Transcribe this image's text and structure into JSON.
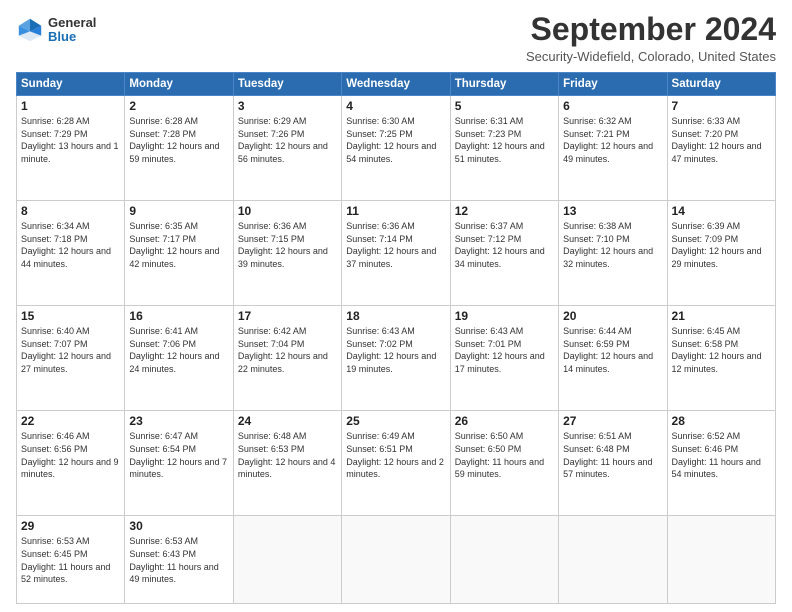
{
  "header": {
    "logo": {
      "general": "General",
      "blue": "Blue"
    },
    "title": "September 2024",
    "location": "Security-Widefield, Colorado, United States"
  },
  "days_of_week": [
    "Sunday",
    "Monday",
    "Tuesday",
    "Wednesday",
    "Thursday",
    "Friday",
    "Saturday"
  ],
  "weeks": [
    [
      {
        "day": 1,
        "sunrise": "6:28 AM",
        "sunset": "7:29 PM",
        "daylight": "13 hours and 1 minute."
      },
      {
        "day": 2,
        "sunrise": "6:28 AM",
        "sunset": "7:28 PM",
        "daylight": "12 hours and 59 minutes."
      },
      {
        "day": 3,
        "sunrise": "6:29 AM",
        "sunset": "7:26 PM",
        "daylight": "12 hours and 56 minutes."
      },
      {
        "day": 4,
        "sunrise": "6:30 AM",
        "sunset": "7:25 PM",
        "daylight": "12 hours and 54 minutes."
      },
      {
        "day": 5,
        "sunrise": "6:31 AM",
        "sunset": "7:23 PM",
        "daylight": "12 hours and 51 minutes."
      },
      {
        "day": 6,
        "sunrise": "6:32 AM",
        "sunset": "7:21 PM",
        "daylight": "12 hours and 49 minutes."
      },
      {
        "day": 7,
        "sunrise": "6:33 AM",
        "sunset": "7:20 PM",
        "daylight": "12 hours and 47 minutes."
      }
    ],
    [
      {
        "day": 8,
        "sunrise": "6:34 AM",
        "sunset": "7:18 PM",
        "daylight": "12 hours and 44 minutes."
      },
      {
        "day": 9,
        "sunrise": "6:35 AM",
        "sunset": "7:17 PM",
        "daylight": "12 hours and 42 minutes."
      },
      {
        "day": 10,
        "sunrise": "6:36 AM",
        "sunset": "7:15 PM",
        "daylight": "12 hours and 39 minutes."
      },
      {
        "day": 11,
        "sunrise": "6:36 AM",
        "sunset": "7:14 PM",
        "daylight": "12 hours and 37 minutes."
      },
      {
        "day": 12,
        "sunrise": "6:37 AM",
        "sunset": "7:12 PM",
        "daylight": "12 hours and 34 minutes."
      },
      {
        "day": 13,
        "sunrise": "6:38 AM",
        "sunset": "7:10 PM",
        "daylight": "12 hours and 32 minutes."
      },
      {
        "day": 14,
        "sunrise": "6:39 AM",
        "sunset": "7:09 PM",
        "daylight": "12 hours and 29 minutes."
      }
    ],
    [
      {
        "day": 15,
        "sunrise": "6:40 AM",
        "sunset": "7:07 PM",
        "daylight": "12 hours and 27 minutes."
      },
      {
        "day": 16,
        "sunrise": "6:41 AM",
        "sunset": "7:06 PM",
        "daylight": "12 hours and 24 minutes."
      },
      {
        "day": 17,
        "sunrise": "6:42 AM",
        "sunset": "7:04 PM",
        "daylight": "12 hours and 22 minutes."
      },
      {
        "day": 18,
        "sunrise": "6:43 AM",
        "sunset": "7:02 PM",
        "daylight": "12 hours and 19 minutes."
      },
      {
        "day": 19,
        "sunrise": "6:43 AM",
        "sunset": "7:01 PM",
        "daylight": "12 hours and 17 minutes."
      },
      {
        "day": 20,
        "sunrise": "6:44 AM",
        "sunset": "6:59 PM",
        "daylight": "12 hours and 14 minutes."
      },
      {
        "day": 21,
        "sunrise": "6:45 AM",
        "sunset": "6:58 PM",
        "daylight": "12 hours and 12 minutes."
      }
    ],
    [
      {
        "day": 22,
        "sunrise": "6:46 AM",
        "sunset": "6:56 PM",
        "daylight": "12 hours and 9 minutes."
      },
      {
        "day": 23,
        "sunrise": "6:47 AM",
        "sunset": "6:54 PM",
        "daylight": "12 hours and 7 minutes."
      },
      {
        "day": 24,
        "sunrise": "6:48 AM",
        "sunset": "6:53 PM",
        "daylight": "12 hours and 4 minutes."
      },
      {
        "day": 25,
        "sunrise": "6:49 AM",
        "sunset": "6:51 PM",
        "daylight": "12 hours and 2 minutes."
      },
      {
        "day": 26,
        "sunrise": "6:50 AM",
        "sunset": "6:50 PM",
        "daylight": "11 hours and 59 minutes."
      },
      {
        "day": 27,
        "sunrise": "6:51 AM",
        "sunset": "6:48 PM",
        "daylight": "11 hours and 57 minutes."
      },
      {
        "day": 28,
        "sunrise": "6:52 AM",
        "sunset": "6:46 PM",
        "daylight": "11 hours and 54 minutes."
      }
    ],
    [
      {
        "day": 29,
        "sunrise": "6:53 AM",
        "sunset": "6:45 PM",
        "daylight": "11 hours and 52 minutes."
      },
      {
        "day": 30,
        "sunrise": "6:53 AM",
        "sunset": "6:43 PM",
        "daylight": "11 hours and 49 minutes."
      },
      null,
      null,
      null,
      null,
      null
    ]
  ]
}
